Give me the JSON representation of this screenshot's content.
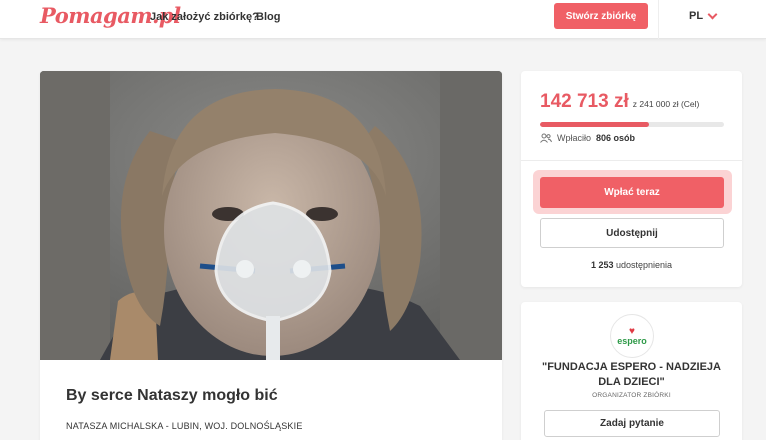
{
  "header": {
    "logo": "Pomagam.pl",
    "nav": {
      "how_to": "Jak założyć zbiórkę?",
      "blog": "Blog"
    },
    "create_button": "Stwórz zbiórkę",
    "language": "PL"
  },
  "campaign": {
    "title": "By serce Nataszy mogło bić",
    "organizer_line": "NATASZA MICHALSKA - LUBIN, WOJ. DOLNOŚLĄSKIE"
  },
  "donation": {
    "raised": "142 713 zł",
    "goal_text": "z 241 000 zł (Cel)",
    "progress_fraction": 0.592,
    "donors_prefix": "Wpłaciło",
    "donors_count": "806 osób",
    "donate_button": "Wpłać teraz",
    "share_button": "Udostępnij",
    "shares_count": "1 253",
    "shares_suffix": "udostępnienia"
  },
  "organization": {
    "logo_text": "espero",
    "name": "\"FUNDACJA ESPERO - NADZIEJA DLA DZIECI\"",
    "role": "ORGANIZATOR ZBIÓRKI",
    "ask_button": "Zadaj pytanie"
  },
  "colors": {
    "accent": "#e85a63",
    "button": "#f06066",
    "org_green": "#2e9a48"
  }
}
